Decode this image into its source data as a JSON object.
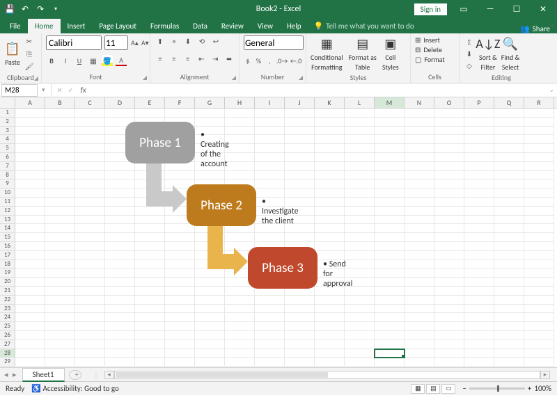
{
  "title": "Book2 - Excel",
  "signin": "Sign in",
  "tabs": [
    "File",
    "Home",
    "Insert",
    "Page Layout",
    "Formulas",
    "Data",
    "Review",
    "View",
    "Help"
  ],
  "active_tab": "Home",
  "tell_me": "Tell me what you want to do",
  "share": "Share",
  "ribbon": {
    "clipboard": {
      "label": "Clipboard",
      "paste": "Paste"
    },
    "font": {
      "label": "Font",
      "name": "Calibri",
      "size": "11"
    },
    "alignment": {
      "label": "Alignment"
    },
    "number": {
      "label": "Number",
      "format": "General"
    },
    "styles": {
      "label": "Styles",
      "cf": "Conditional",
      "cf2": "Formatting",
      "ft": "Format as",
      "ft2": "Table",
      "cs": "Cell",
      "cs2": "Styles"
    },
    "cells": {
      "label": "Cells",
      "insert": "Insert",
      "delete": "Delete",
      "format": "Format"
    },
    "editing": {
      "label": "Editing",
      "sort": "Sort &",
      "sort2": "Filter",
      "find": "Find &",
      "find2": "Select"
    }
  },
  "namebox": "M28",
  "formula": "",
  "cols": [
    "A",
    "B",
    "C",
    "D",
    "E",
    "F",
    "G",
    "H",
    "I",
    "J",
    "K",
    "L",
    "M",
    "N",
    "O",
    "P",
    "Q",
    "R"
  ],
  "rows": 29,
  "sel": {
    "col": "M",
    "row": 28
  },
  "smartart": {
    "n1": "Phase 1",
    "b1": "Creating of the account",
    "n2": "Phase 2",
    "b2": "Investigate the client",
    "n3": "Phase 3",
    "b3": "Send for approval"
  },
  "sheet": "Sheet1",
  "status": {
    "ready": "Ready",
    "access": "Accessibility: Good to go",
    "zoom": "100%"
  }
}
